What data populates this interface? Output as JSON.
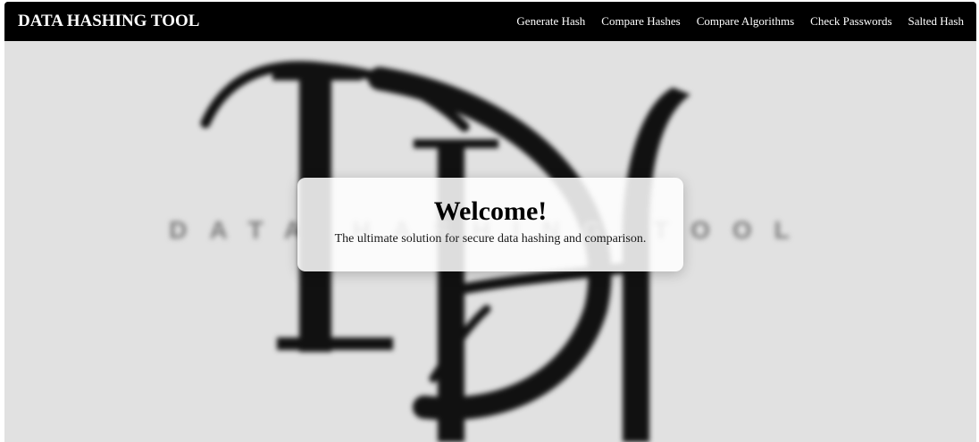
{
  "header": {
    "brand": "DATA HASHING TOOL",
    "nav": [
      {
        "label": "Generate Hash"
      },
      {
        "label": "Compare Hashes"
      },
      {
        "label": "Compare Algorithms"
      },
      {
        "label": "Check Passwords"
      },
      {
        "label": "Salted Hash"
      }
    ]
  },
  "hero": {
    "logo": {
      "monogram": "DH",
      "tagline": "DATA HASHING TOOL"
    },
    "welcome_title": "Welcome!",
    "welcome_subtitle": "The ultimate solution for secure data hashing and comparison."
  },
  "colors": {
    "navbar_bg": "#000000",
    "nav_text": "#ffffff",
    "hero_bg": "#e1e1e1",
    "card_bg": "#ffffff"
  }
}
